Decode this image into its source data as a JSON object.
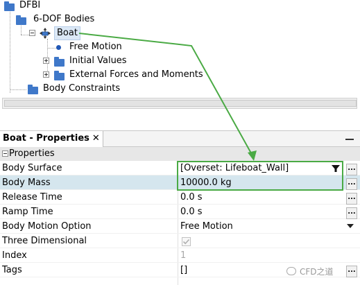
{
  "tree": {
    "nodes": [
      {
        "label": "DFBI"
      },
      {
        "label": "6-DOF Bodies"
      },
      {
        "label": "Boat"
      },
      {
        "label": "Free Motion"
      },
      {
        "label": "Initial Values"
      },
      {
        "label": "External Forces and Moments"
      },
      {
        "label": "Body Constraints"
      }
    ],
    "selected": "Boat"
  },
  "properties_panel": {
    "tab_label": "Boat - Properties",
    "close_glyph": "✕",
    "section_label": "Properties",
    "rows": [
      {
        "name": "Body Surface",
        "value": "[Overset: Lifeboat_Wall]"
      },
      {
        "name": "Body Mass",
        "value": "10000.0 kg"
      },
      {
        "name": "Release Time",
        "value": "0.0 s"
      },
      {
        "name": "Ramp Time",
        "value": "0.0 s"
      },
      {
        "name": "Body Motion Option",
        "value": "Free Motion"
      },
      {
        "name": "Three Dimensional",
        "value": "✓"
      },
      {
        "name": "Index",
        "value": "1"
      },
      {
        "name": "Tags",
        "value": "[]"
      }
    ],
    "ellipsis_label": "..."
  },
  "annotation": {
    "color": "#4aaa44"
  },
  "watermark": {
    "text": "CFD之道"
  },
  "colors": {
    "folder": "#3f78c9",
    "highlight_row": "#d5e6ee",
    "selection": "#dbe8f6"
  }
}
